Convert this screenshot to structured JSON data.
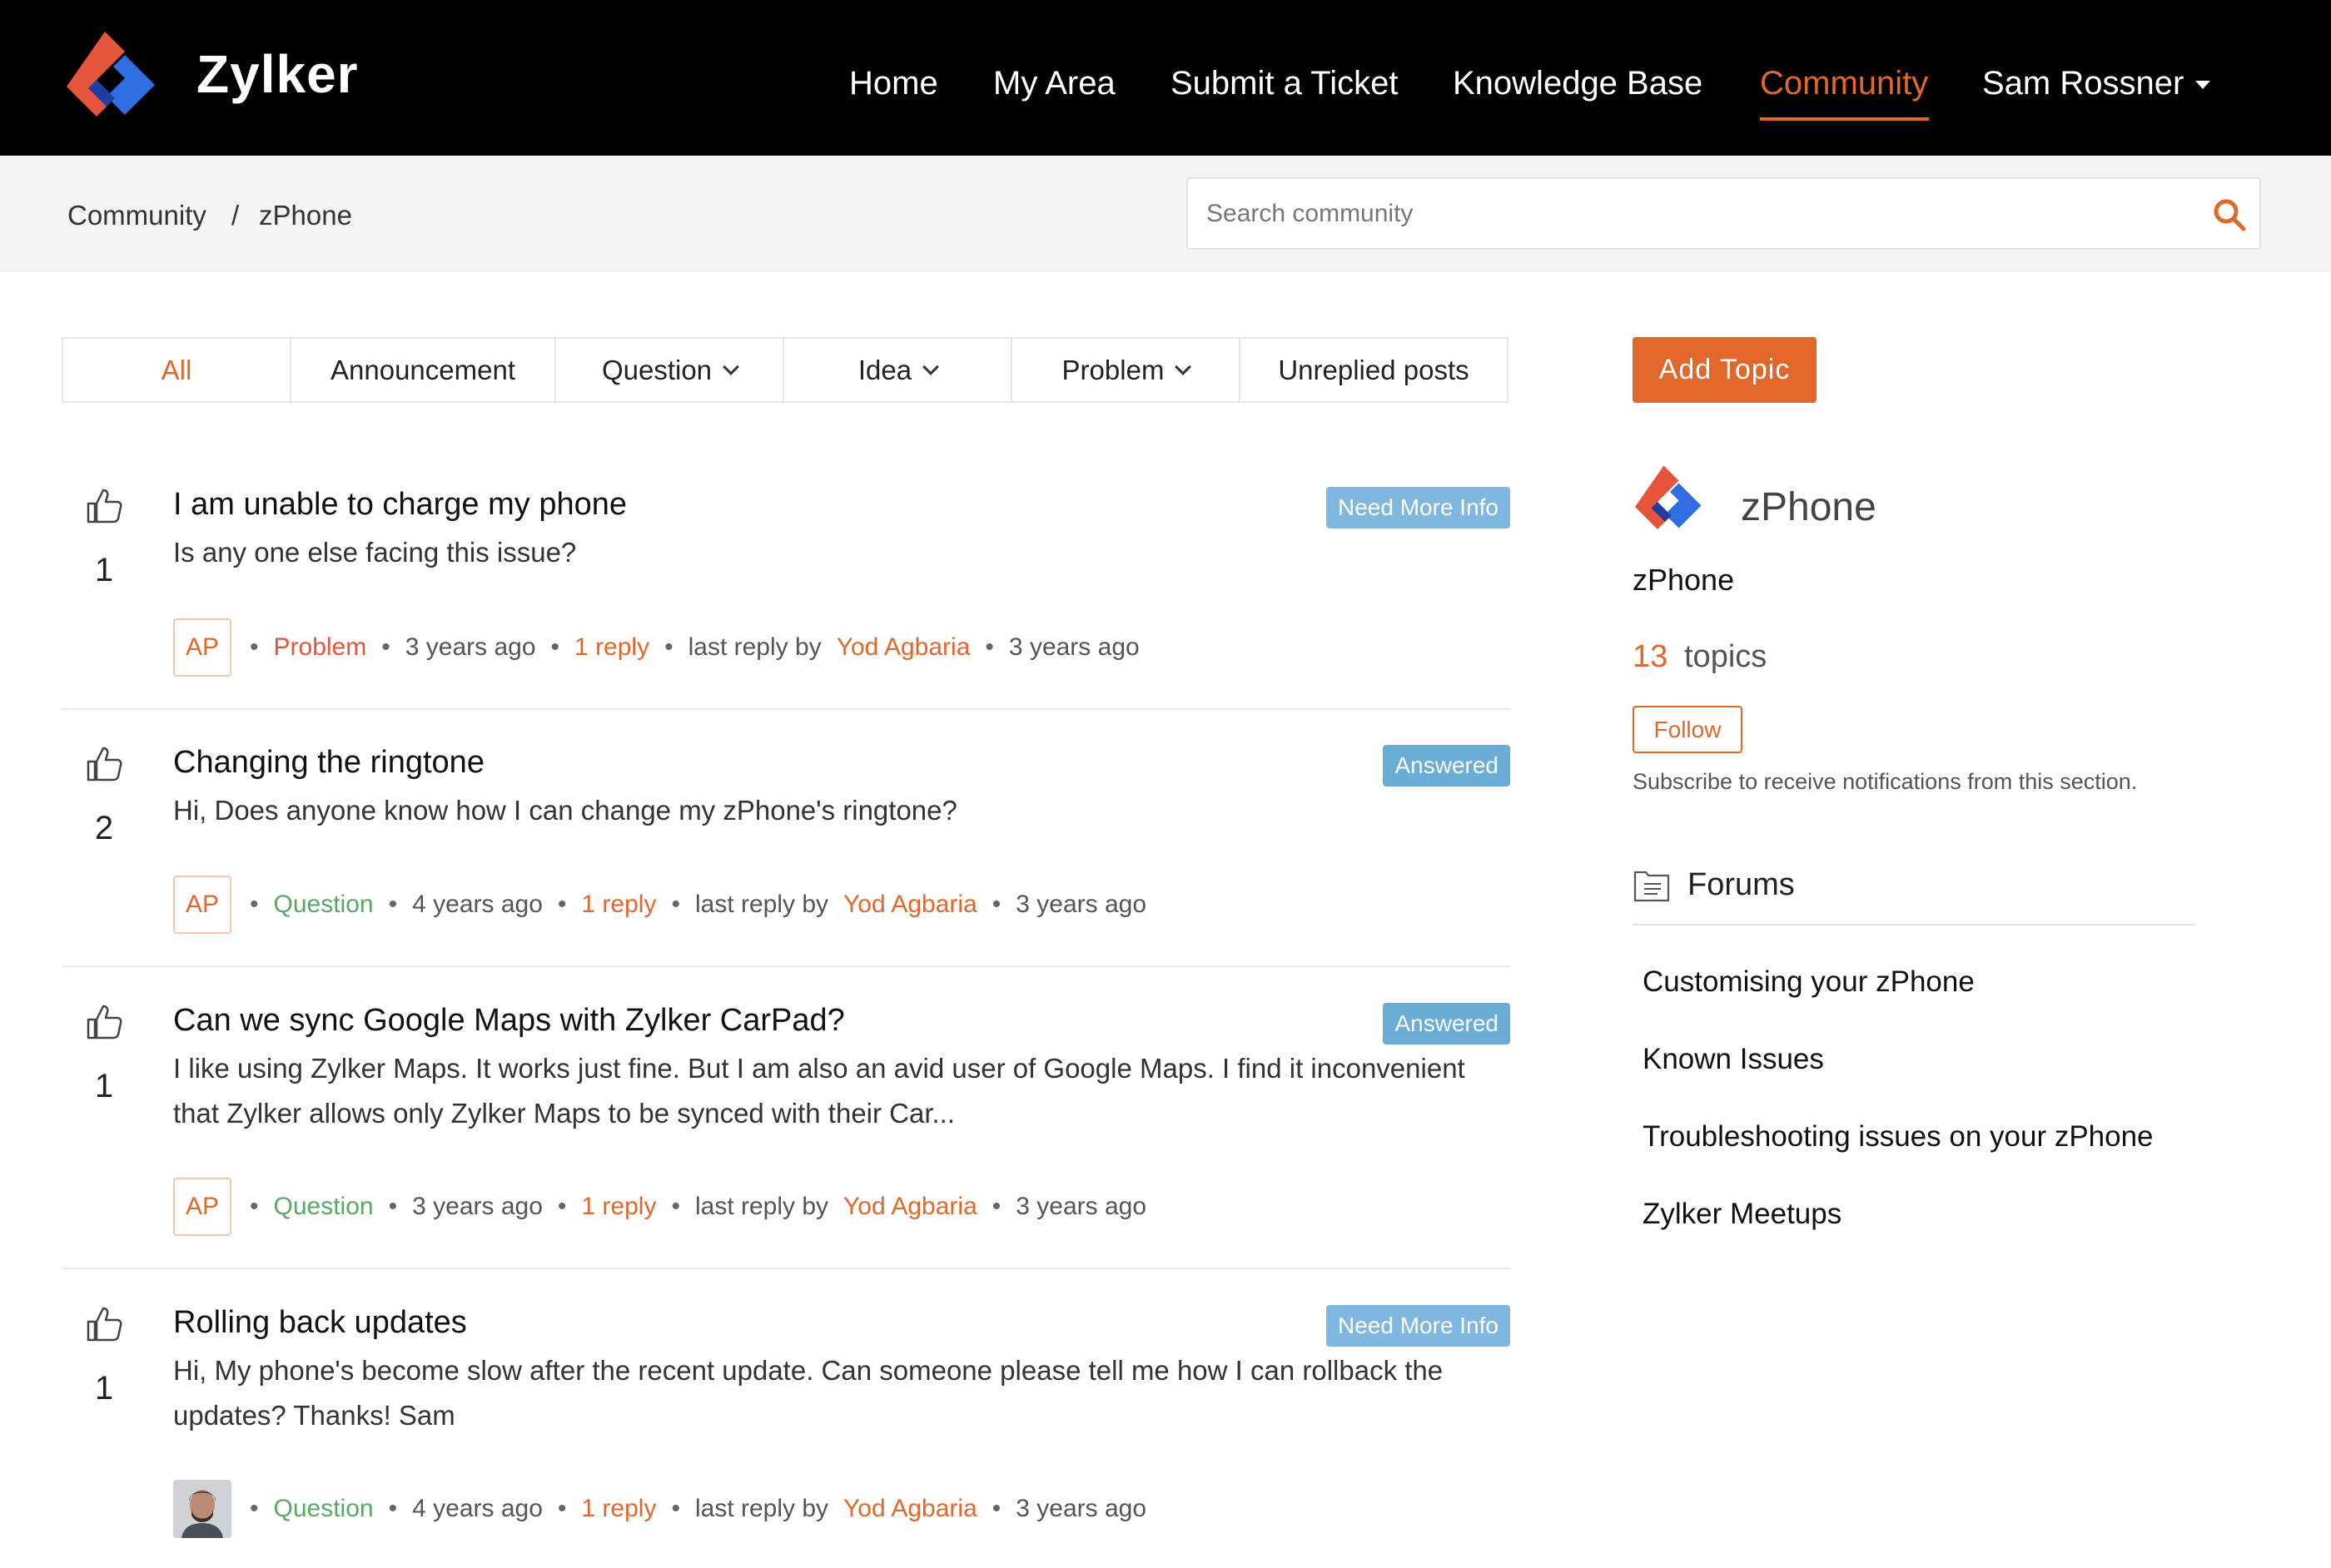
{
  "header": {
    "brand": "Zylker",
    "nav": [
      "Home",
      "My Area",
      "Submit a Ticket",
      "Knowledge Base",
      "Community"
    ],
    "active_nav": "Community",
    "user": "Sam Rossner"
  },
  "breadcrumb": {
    "root": "Community",
    "separator": "/",
    "current": "zPhone"
  },
  "search": {
    "placeholder": "Search community"
  },
  "filters": {
    "all": "All",
    "announcement": "Announcement",
    "question": "Question",
    "idea": "Idea",
    "problem": "Problem",
    "unreplied": "Unreplied posts"
  },
  "posts": [
    {
      "title": "I am unable to charge my phone",
      "votes": "1",
      "status": "Need More Info",
      "excerpt": "Is any one else facing this issue?",
      "author_initials": "AP",
      "category": "Problem",
      "posted": "3 years ago",
      "replies": "1 reply",
      "last_reply_label": "last reply by",
      "last_reply_by": "Yod Agbaria",
      "last_reply_time": "3 years ago"
    },
    {
      "title": "Changing the ringtone",
      "votes": "2",
      "status": "Answered",
      "excerpt": "Hi, Does anyone know how I can change my zPhone's ringtone?",
      "author_initials": "AP",
      "category": "Question",
      "posted": "4 years ago",
      "replies": "1 reply",
      "last_reply_label": "last reply by",
      "last_reply_by": "Yod Agbaria",
      "last_reply_time": "3 years ago"
    },
    {
      "title": "Can we sync Google Maps with Zylker CarPad?",
      "votes": "1",
      "status": "Answered",
      "excerpt": "I like using Zylker Maps. It works just fine. But I am also an avid user of Google Maps. I find it inconvenient that Zylker allows only Zylker Maps to be synced with their Car...",
      "author_initials": "AP",
      "category": "Question",
      "posted": "3 years ago",
      "replies": "1 reply",
      "last_reply_label": "last reply by",
      "last_reply_by": "Yod Agbaria",
      "last_reply_time": "3 years ago"
    },
    {
      "title": "Rolling back updates",
      "votes": "1",
      "status": "Need More Info",
      "excerpt": "Hi, My phone's become slow after the recent update. Can someone please tell me how I can rollback the updates? Thanks! Sam",
      "category": "Question",
      "posted": "4 years ago",
      "replies": "1 reply",
      "last_reply_label": "last reply by",
      "last_reply_by": "Yod Agbaria",
      "last_reply_time": "3 years ago"
    }
  ],
  "sidebar": {
    "add_topic": "Add Topic",
    "forum_name": "zPhone",
    "topics_count": "13",
    "topics_label": "topics",
    "follow": "Follow",
    "follow_note": "Subscribe to receive notifications from this section.",
    "forums_title": "Forums",
    "forums": [
      "Customising your zPhone",
      "Known Issues",
      "Troubleshooting issues on your zPhone",
      "Zylker Meetups"
    ]
  },
  "colors": {
    "accent": "#e2672a",
    "header_bg": "#000000",
    "badge_blue": "#7fb7e0",
    "question_green": "#5aa866",
    "problem_red": "#e4553b"
  }
}
